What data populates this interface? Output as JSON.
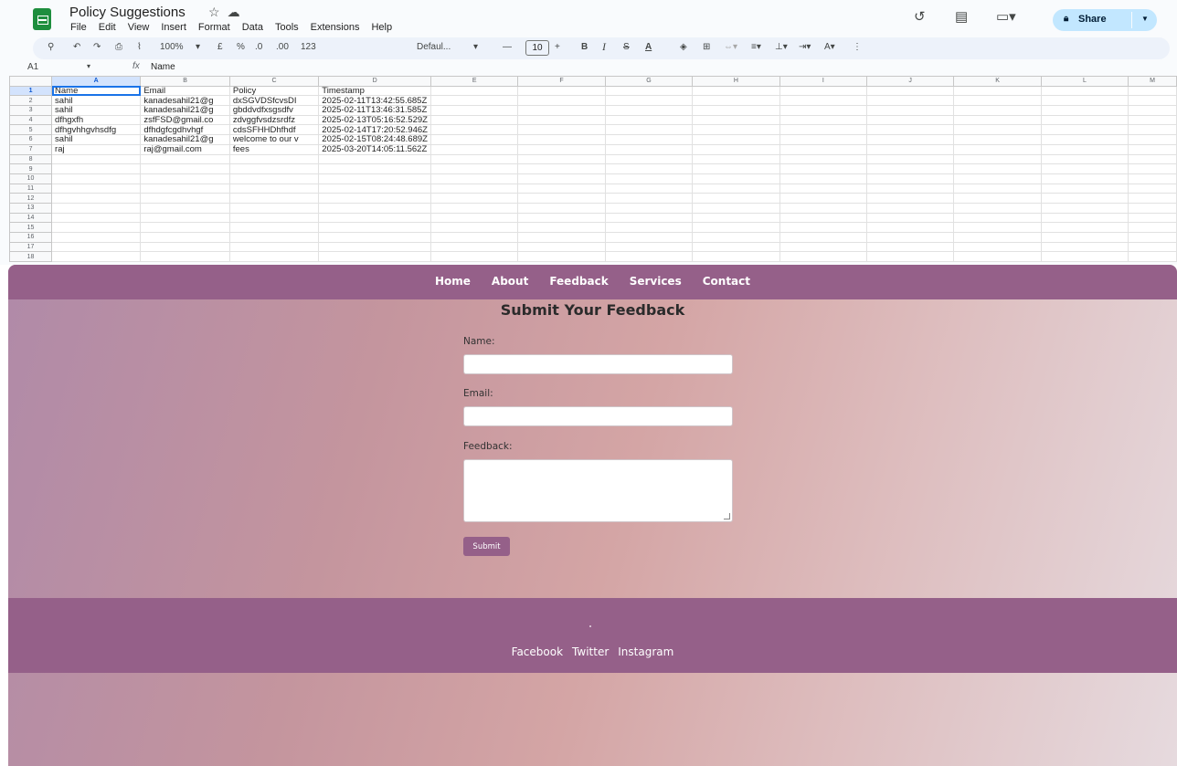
{
  "sheets": {
    "doc_title": "Policy Suggestions",
    "menu": [
      "File",
      "Edit",
      "View",
      "Insert",
      "Format",
      "Data",
      "Tools",
      "Extensions",
      "Help"
    ],
    "share_label": "Share",
    "toolbar": {
      "zoom": "100%",
      "currency": "£",
      "percent": "%",
      "dec_decrease": ".0",
      "dec_increase": ".00",
      "number_format": "123",
      "font": "Defaul...",
      "font_size": "10",
      "bold": "B",
      "italic": "I",
      "strike": "S",
      "text_color": "A"
    },
    "name_box": "A1",
    "formula_value": "Name",
    "columns": [
      "A",
      "B",
      "C",
      "D",
      "E",
      "F",
      "G",
      "H",
      "I",
      "J",
      "K",
      "L",
      "M"
    ],
    "row_numbers": [
      "1",
      "2",
      "3",
      "4",
      "5",
      "6",
      "7",
      "8",
      "9",
      "10",
      "11",
      "12",
      "13",
      "14",
      "15",
      "16",
      "17",
      "18"
    ],
    "rows": [
      [
        "Name",
        "Email",
        "Policy",
        "Timestamp"
      ],
      [
        "sahil",
        "kanadesahil21@g",
        "dxSGVDSfcvsDI",
        "2025-02-11T13:42:55.685Z"
      ],
      [
        "sahil",
        "kanadesahil21@g",
        "gbddvdfxsgsdfv",
        "2025-02-11T13:46:31.585Z"
      ],
      [
        "dfhgxfh",
        "zsfFSD@gmail.co",
        "zdvggfvsdzsrdfz",
        "2025-02-13T05:16:52.529Z"
      ],
      [
        "dfhgvhhgvhsdfg",
        "dfhdgfcgdhvhgf",
        "cdsSFHHDhfhdf",
        "2025-02-14T17:20:52.946Z"
      ],
      [
        "sahil",
        "kanadesahil21@g",
        "welcome to our v",
        "2025-02-15T08:24:48.689Z"
      ],
      [
        "raj",
        "raj@gmail.com",
        "fees",
        "2025-03-20T14:05:11.562Z"
      ]
    ]
  },
  "site": {
    "nav": [
      "Home",
      "About",
      "Feedback",
      "Services",
      "Contact"
    ],
    "form_title": "Submit Your Feedback",
    "labels": {
      "name": "Name:",
      "email": "Email:",
      "feedback": "Feedback:"
    },
    "submit_label": "Submit",
    "footer_dot": ".",
    "social": [
      "Facebook",
      "Twitter",
      "Instagram"
    ],
    "colors": {
      "nav_bg": "#956089",
      "button_bg": "#956089"
    }
  }
}
